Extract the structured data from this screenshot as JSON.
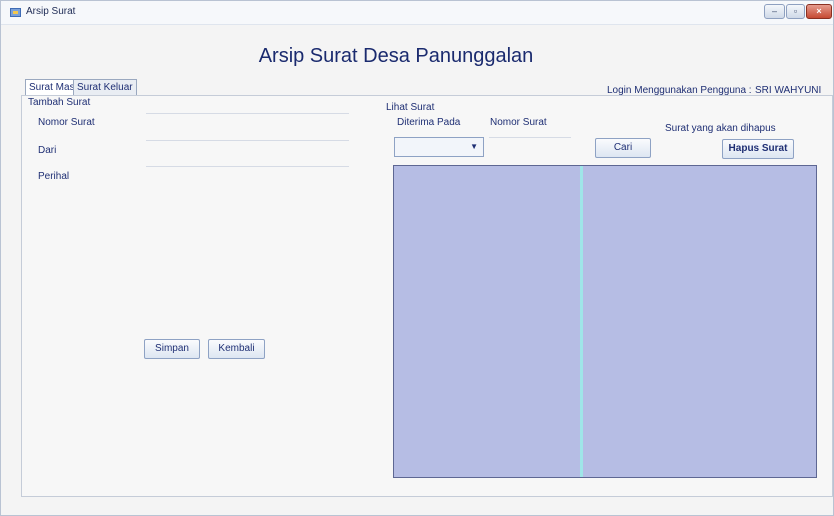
{
  "window": {
    "title": "Arsip Surat",
    "controls": {
      "minimize": "–",
      "maximize": "▫",
      "close": "×"
    }
  },
  "header": {
    "title": "Arsip Surat Desa Panunggalan",
    "login_label": "Login Menggunakan Pengguna :",
    "login_user": "SRI WAHYUNI"
  },
  "tabs": [
    {
      "label": "Surat Masuk",
      "selected": true
    },
    {
      "label": "Surat Keluar",
      "selected": false
    }
  ],
  "tambah": {
    "section_label": "Tambah Surat",
    "nomor_label": "Nomor Surat",
    "dari_label": "Dari",
    "perihal_label": "Perihal",
    "simpan_label": "Simpan",
    "kembali_label": "Kembali"
  },
  "lihat": {
    "section_label": "Lihat Surat",
    "diterima_label": "Diterima Pada",
    "nomor_label": "Nomor Surat",
    "dropdown_value": "",
    "cari_label": "Cari",
    "hapus_caption": "Surat yang akan dihapus",
    "hapus_label": "Hapus Surat"
  },
  "icons": {
    "app": "app-window-icon",
    "dropdown": "chevron-down-icon"
  },
  "colors": {
    "accent_text": "#1f2f74",
    "grid_background": "#b6bde4",
    "grid_divider": "#9fe6e8",
    "close_button": "#c64a33"
  }
}
